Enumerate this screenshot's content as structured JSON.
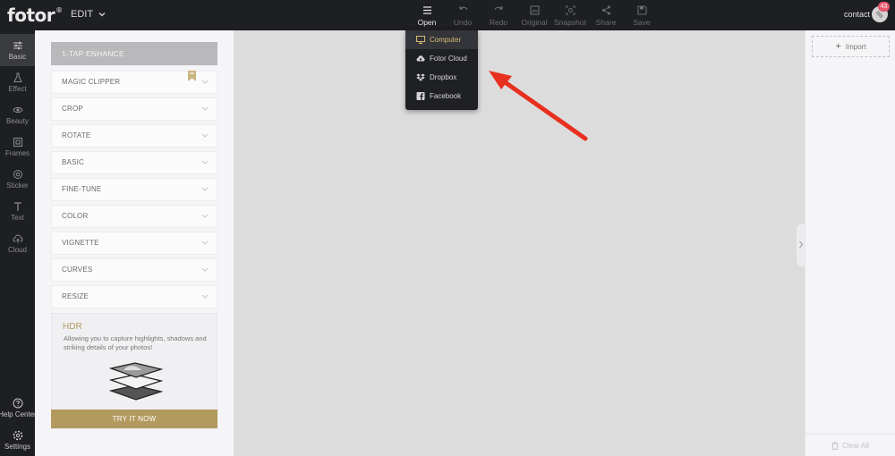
{
  "app": {
    "logo": "fotor",
    "logo_mark": "®",
    "mode": "EDIT",
    "contact": "contact",
    "notification_count": "43"
  },
  "toolbar": [
    {
      "label": "Open",
      "icon": "menu-icon",
      "state": "active"
    },
    {
      "label": "Undo",
      "icon": "undo-icon",
      "state": "disabled"
    },
    {
      "label": "Redo",
      "icon": "redo-icon",
      "state": "disabled"
    },
    {
      "label": "Original",
      "icon": "original-icon",
      "state": "disabled"
    },
    {
      "label": "Snapshot",
      "icon": "snapshot-icon",
      "state": "disabled"
    },
    {
      "label": "Share",
      "icon": "share-icon",
      "state": "disabled"
    },
    {
      "label": "Save",
      "icon": "save-icon",
      "state": "disabled"
    }
  ],
  "open_menu": [
    {
      "label": "Computer",
      "icon": "computer-icon",
      "highlighted": true
    },
    {
      "label": "Fotor Cloud",
      "icon": "cloud-icon",
      "highlighted": false
    },
    {
      "label": "Dropbox",
      "icon": "dropbox-icon",
      "highlighted": false
    },
    {
      "label": "Facebook",
      "icon": "facebook-icon",
      "highlighted": false
    }
  ],
  "nav": {
    "items": [
      {
        "label": "Basic",
        "icon": "sliders-icon",
        "active": true
      },
      {
        "label": "Effect",
        "icon": "flask-icon",
        "active": false
      },
      {
        "label": "Beauty",
        "icon": "eye-icon",
        "active": false
      },
      {
        "label": "Frames",
        "icon": "frame-icon",
        "active": false
      },
      {
        "label": "Sticker",
        "icon": "sticker-icon",
        "active": false
      },
      {
        "label": "Text",
        "icon": "text-icon",
        "active": false
      },
      {
        "label": "Cloud",
        "icon": "cloud-upload-icon",
        "active": false
      }
    ],
    "bottom": [
      {
        "label": "Help Center",
        "icon": "help-icon"
      },
      {
        "label": "Settings",
        "icon": "settings-icon"
      }
    ]
  },
  "panel": {
    "enhance": "1-TAP ENHANCE",
    "sections": [
      "MAGIC CLIPPER",
      "CROP",
      "ROTATE",
      "BASIC",
      "FINE-TUNE",
      "COLOR",
      "VIGNETTE",
      "CURVES",
      "RESIZE"
    ],
    "hdr": {
      "title": "HDR",
      "description": "Allowing you to capture highlights, shadows and striking details of your photos!",
      "cta": "TRY IT NOW"
    }
  },
  "right_panel": {
    "import": "Import",
    "clear_all": "Clear All"
  },
  "colors": {
    "dark_bar": "#1e1f22",
    "accent_gold": "#b29a5f",
    "annotation_red": "#e8301f",
    "badge": "#e8576c"
  }
}
